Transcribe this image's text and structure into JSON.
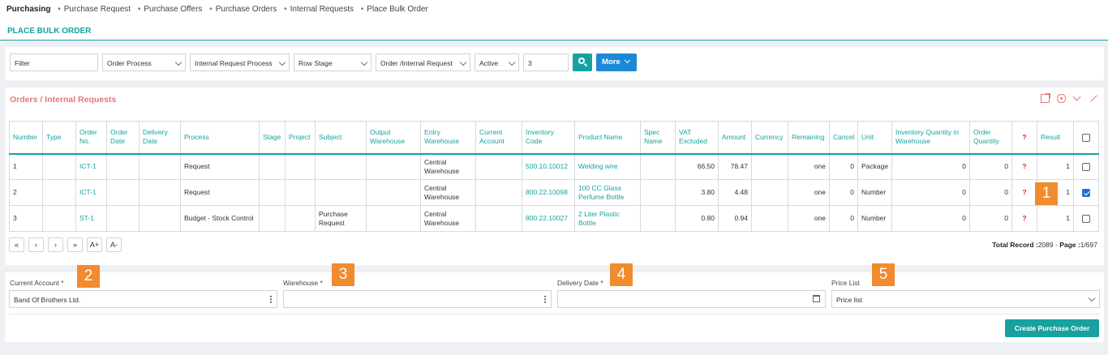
{
  "breadcrumb": [
    "Purchasing",
    "Purchase Request",
    "Purchase Offers",
    "Purchase Orders",
    "Internal Requests",
    "Place Bulk Order"
  ],
  "page_title": "PLACE BULK ORDER",
  "filters": {
    "filter_placeholder": "Filter",
    "order_process": "Order Process",
    "internal_request_process": "Internal Request Process",
    "row_stage": "Row Stage",
    "order_internal_request": "Order /Internal Request",
    "status": "Active",
    "count": "3",
    "more_label": "More"
  },
  "panel": {
    "title": "Orders / Internal Requests",
    "columns": [
      "Number",
      "Type",
      "Order No.",
      "Order Date",
      "Delivery Date",
      "Process",
      "Stage",
      "Project",
      "Subject",
      "Output Warehouse",
      "Entry Warehouse",
      "Current Account",
      "Inventory Code",
      "Product Name",
      "Spec Name",
      "VAT Excluded",
      "Amount",
      "Currency",
      "Remaining",
      "Cancel",
      "Unit",
      "Inventory Quantity in Warehouse",
      "Order Quantity",
      "?",
      "Result"
    ],
    "rows": [
      {
        "number": "1",
        "type": "",
        "order_no": "ICT-1",
        "order_date": "",
        "delivery_date": "",
        "process": "Request",
        "stage": "",
        "project": "",
        "subject": "",
        "output_warehouse": "",
        "entry_warehouse": "Central Warehouse",
        "current_account": "",
        "inventory_code": "500.10.10012",
        "product_name": "Welding wire",
        "spec_name": "",
        "vat_excluded": "66.50",
        "amount": "78.47",
        "currency": "",
        "remaining": "one",
        "cancel": "0",
        "unit": "Package",
        "inv_qty": "0",
        "order_qty": "0",
        "q": "?",
        "result": "1",
        "checked": false
      },
      {
        "number": "2",
        "type": "",
        "order_no": "ICT-1",
        "order_date": "",
        "delivery_date": "",
        "process": "Request",
        "stage": "",
        "project": "",
        "subject": "",
        "output_warehouse": "",
        "entry_warehouse": "Central Warehouse",
        "current_account": "",
        "inventory_code": "800.22.10098",
        "product_name": "100 CC Glass Perfume Bottle",
        "spec_name": "",
        "vat_excluded": "3.80",
        "amount": "4.48",
        "currency": "",
        "remaining": "one",
        "cancel": "0",
        "unit": "Number",
        "inv_qty": "0",
        "order_qty": "0",
        "q": "?",
        "result": "1",
        "checked": true
      },
      {
        "number": "3",
        "type": "",
        "order_no": "ST-1",
        "order_date": "",
        "delivery_date": "",
        "process": "Budget - Stock Control",
        "stage": "",
        "project": "",
        "subject": "Purchase Request",
        "output_warehouse": "",
        "entry_warehouse": "Central Warehouse",
        "current_account": "",
        "inventory_code": "800.22.10027",
        "product_name": "2 Liter Plastic Bottle",
        "spec_name": "",
        "vat_excluded": "0.80",
        "amount": "0.94",
        "currency": "",
        "remaining": "one",
        "cancel": "0",
        "unit": "Number",
        "inv_qty": "0",
        "order_qty": "0",
        "q": "?",
        "result": "1",
        "checked": false
      }
    ],
    "pager": [
      "«",
      "‹",
      "›",
      "»",
      "A+",
      "A-"
    ],
    "total_record_label": "Total Record :",
    "total_record_value": "2089",
    "page_label": "Page :",
    "page_value": "1/697"
  },
  "markers": [
    "1",
    "2",
    "3",
    "4",
    "5"
  ],
  "form": {
    "current_account_label": "Current Account *",
    "current_account_value": "Band Of Brothers Ltd.",
    "warehouse_label": "Warehouse *",
    "warehouse_value": "",
    "delivery_date_label": "Delivery Date *",
    "delivery_date_value": "",
    "price_list_label": "Price List",
    "price_list_value": "Price list",
    "create_button": "Create Purchase Order"
  },
  "colors": {
    "accent": "#17a2a0",
    "primary": "#1e88d6",
    "panel_title": "#e87873",
    "marker": "#f28a2e"
  }
}
